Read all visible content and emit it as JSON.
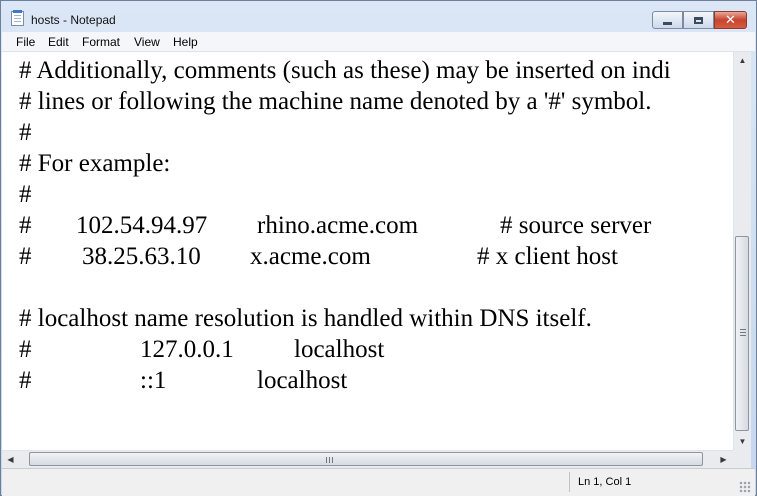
{
  "window": {
    "title": "hosts - Notepad"
  },
  "menu": [
    "File",
    "Edit",
    "Format",
    "View",
    "Help"
  ],
  "editor": {
    "line1": "# Additionally, comments (such as these) may be inserted on indi",
    "line2": "# lines or following the machine name denoted by a '#' symbol.",
    "line3": "#",
    "line4": "# For example:",
    "line5": "#",
    "line6": {
      "hash": "#",
      "ip": "102.54.94.97",
      "host": "rhino.acme.com",
      "comment": "# source server"
    },
    "line7": {
      "hash": "#",
      "ip": "38.25.63.10",
      "host": "x.acme.com",
      "comment": "# x client host"
    },
    "line9": "# localhost name resolution is handled within DNS itself.",
    "line10": {
      "hash": "#",
      "ip": "127.0.0.1",
      "host": "localhost"
    },
    "line11": {
      "hash": "#",
      "ip": "::1",
      "host": "localhost"
    }
  },
  "status": {
    "position": "Ln 1, Col 1"
  },
  "icons": {
    "app": "notepad-icon",
    "minimize": "minimize-icon",
    "maximize": "maximize-icon",
    "close": "close-icon"
  }
}
